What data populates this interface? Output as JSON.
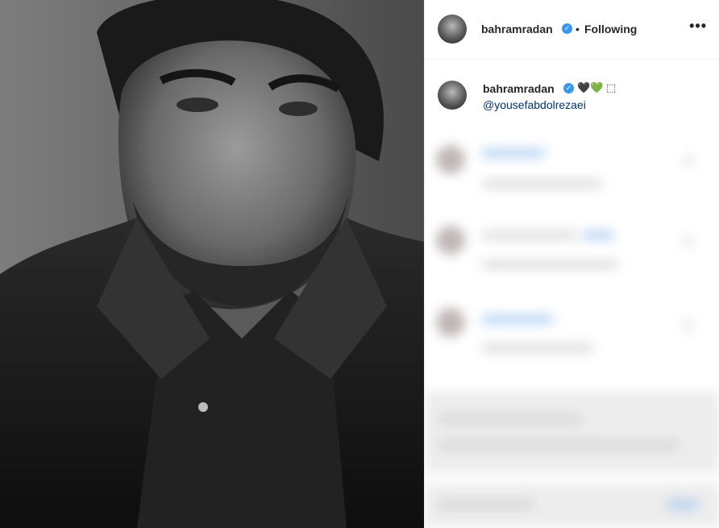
{
  "post": {
    "photo_alt": "",
    "author": {
      "username": "bahramradan",
      "verified_icon": "verified-badge-icon",
      "follow_status": "Following"
    },
    "more_label": "•••",
    "separator": "•",
    "caption": {
      "username": "bahramradan",
      "emojis": "🖤💚 ⬚",
      "mention": "@yousefabdolrezaei"
    },
    "comments_blurred": true
  },
  "colors": {
    "link": "#003569",
    "verified": "#3897f0",
    "border": "#efefef",
    "text": "#262626"
  }
}
